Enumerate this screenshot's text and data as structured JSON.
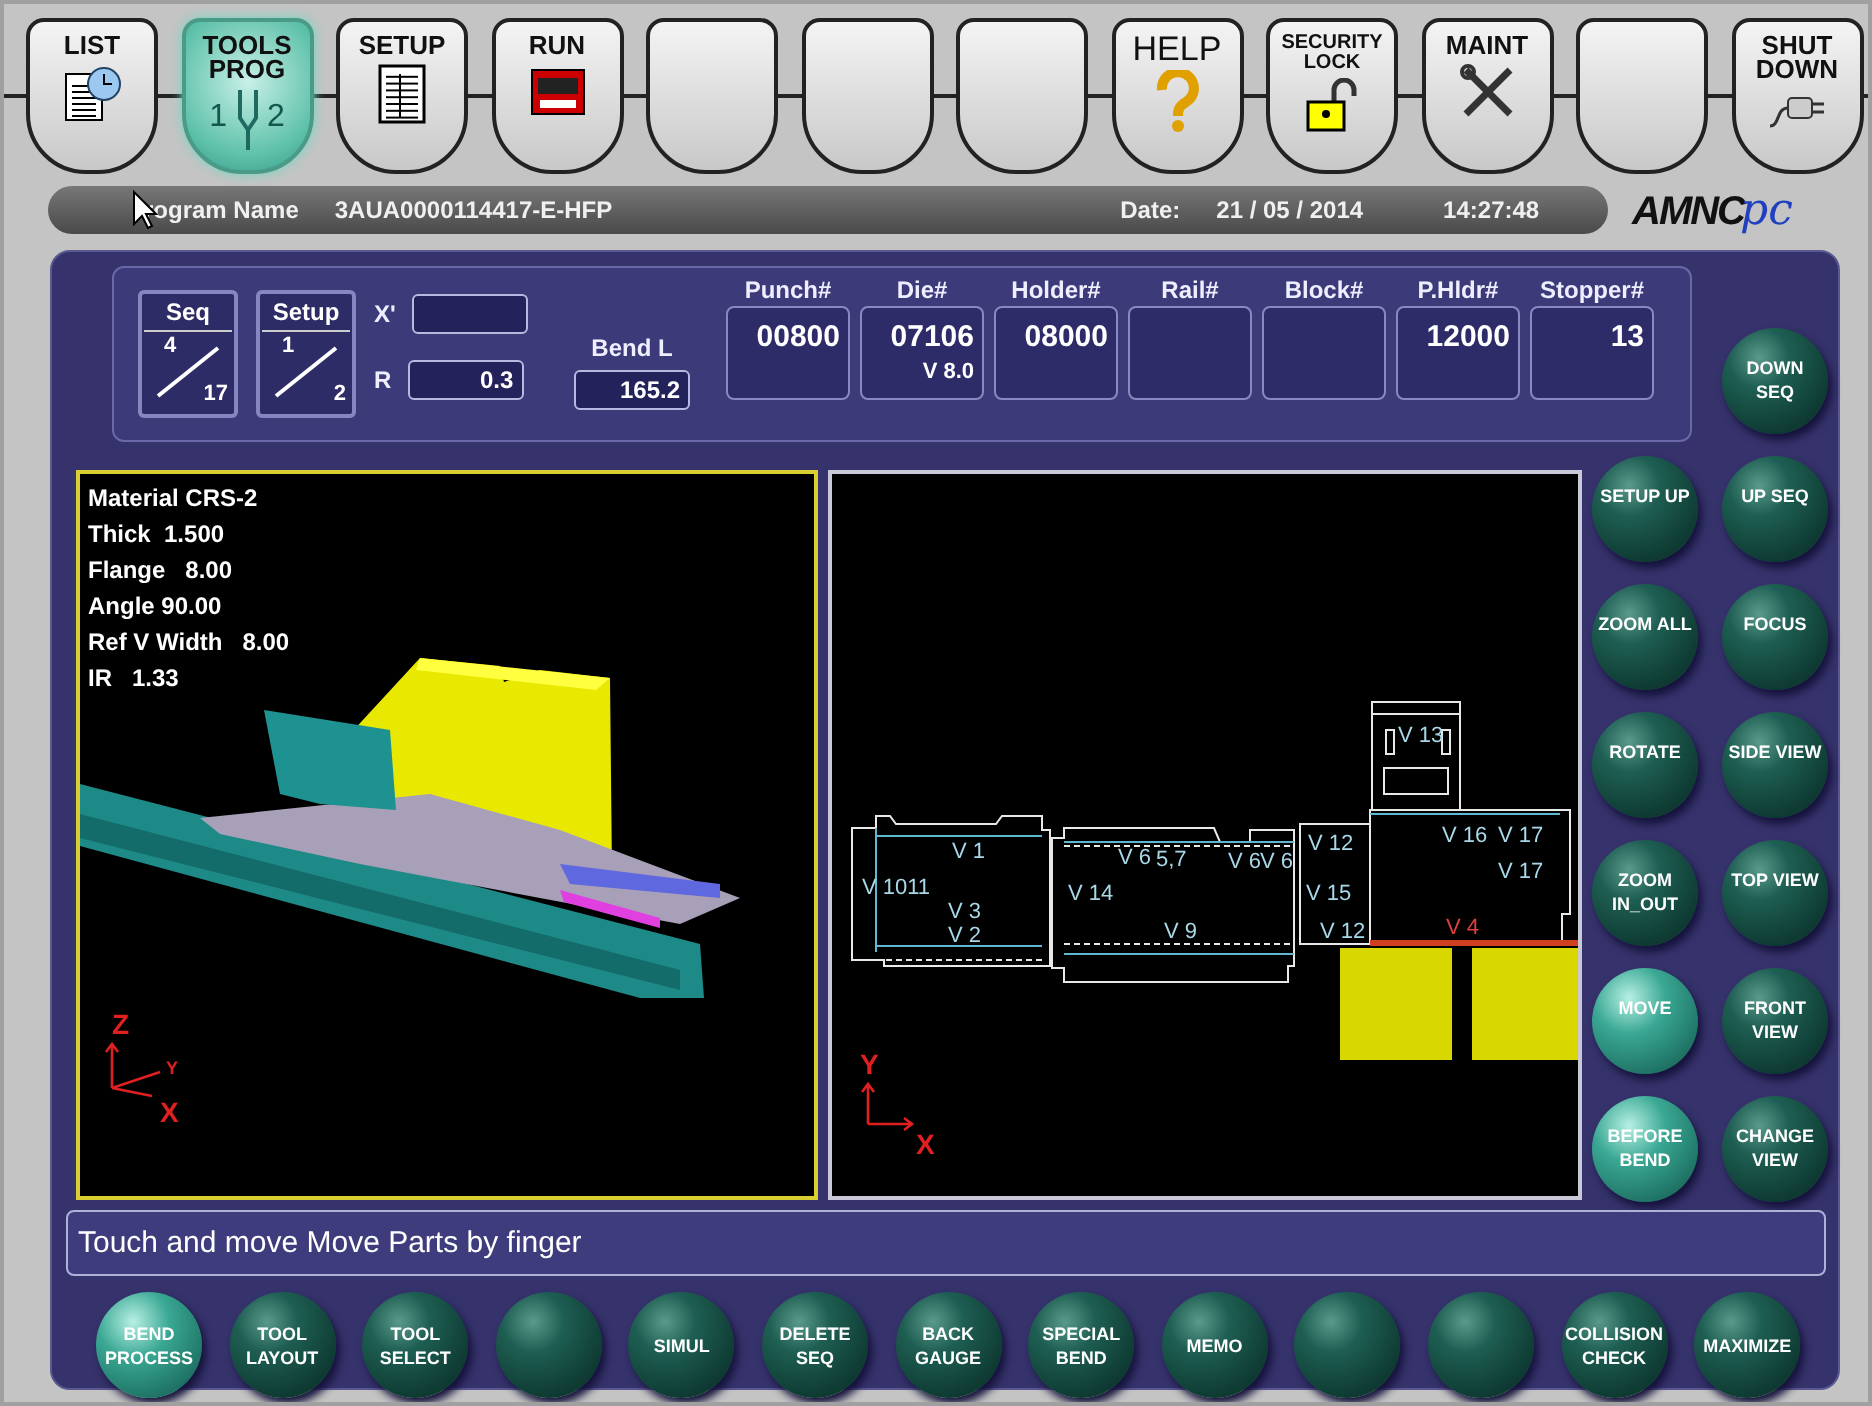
{
  "tabs": [
    {
      "label": "LIST",
      "selected": false
    },
    {
      "label": "TOOLS PROG",
      "selected": true,
      "step_labels": [
        "1",
        "2"
      ]
    },
    {
      "label": "SETUP",
      "selected": false
    },
    {
      "label": "RUN",
      "selected": false
    },
    {
      "selected": false
    },
    {
      "selected": false
    },
    {
      "selected": false
    },
    {
      "label": "HELP",
      "selected": false
    },
    {
      "label": "SECURITY LOCK",
      "selected": false
    },
    {
      "label": "MAINT",
      "selected": false
    },
    {
      "selected": false
    },
    {
      "label": "SHUT DOWN",
      "selected": false
    }
  ],
  "info_bar": {
    "program_label": "rogram Name",
    "program_name": "3AUA0000114417-E-HFP",
    "date_label": "Date:",
    "date": "21 / 05 / 2014",
    "time": "14:27:48",
    "logo": "AMNC",
    "logo_suffix": "pc"
  },
  "header": {
    "seq": {
      "label": "Seq",
      "current": "4",
      "total": "17"
    },
    "setup": {
      "label": "Setup",
      "current": "1",
      "total": "2"
    },
    "x_prime": {
      "label": "X'"
    },
    "r": {
      "label": "R",
      "value": "0.3"
    },
    "bend_l": {
      "label": "Bend L",
      "value": "165.2"
    },
    "tools": [
      {
        "label": "Punch#",
        "value": "00800"
      },
      {
        "label": "Die#",
        "value": "07106",
        "sub": "V 8.0"
      },
      {
        "label": "Holder#",
        "value": "08000"
      },
      {
        "label": "Rail#"
      },
      {
        "label": "Block#"
      },
      {
        "label": "P.Hldr#",
        "value": "12000"
      },
      {
        "label": "Stopper#",
        "value": "13"
      }
    ]
  },
  "view_3d": {
    "info": [
      "Material CRS-2",
      "Thick  1.500",
      "Flange   8.00",
      "Angle 90.00",
      "Ref V Width   8.00",
      "IR   1.33"
    ],
    "axes": [
      "Z",
      "Y",
      "X"
    ]
  },
  "view_2d": {
    "labels": [
      "V 1",
      "V 1011",
      "V 3",
      "V 2",
      "V 14",
      "V 6",
      "5,7",
      "V 9",
      "V 6",
      "V 6",
      "V 12",
      "V 15",
      "V 12",
      "V 13",
      "V 16",
      "V 17",
      "V 17",
      "V 4"
    ],
    "axes": [
      "Y",
      "X"
    ]
  },
  "side_buttons": [
    {
      "label": "DOWN SEQ",
      "active": false
    },
    {
      "label": "SETUP UP",
      "active": false
    },
    {
      "label": "UP SEQ",
      "active": false
    },
    {
      "label": "ZOOM ALL",
      "active": false
    },
    {
      "label": "FOCUS",
      "active": false
    },
    {
      "label": "ROTATE",
      "active": false
    },
    {
      "label": "SIDE VIEW",
      "active": false
    },
    {
      "label": "ZOOM IN_OUT",
      "active": false
    },
    {
      "label": "TOP VIEW",
      "active": false
    },
    {
      "label": "MOVE",
      "active": true
    },
    {
      "label": "FRONT VIEW",
      "active": false
    },
    {
      "label": "BEFORE BEND",
      "active": true
    },
    {
      "label": "CHANGE VIEW",
      "active": false
    }
  ],
  "message": "Touch and move Move Parts by finger",
  "bottom_buttons": [
    {
      "label": "BEND PROCESS",
      "active": true
    },
    {
      "label": "TOOL LAYOUT",
      "active": false
    },
    {
      "label": "TOOL SELECT",
      "active": false
    },
    {
      "active": false
    },
    {
      "label": "SIMUL",
      "active": false
    },
    {
      "label": "DELETE SEQ",
      "active": false
    },
    {
      "label": "BACK GAUGE",
      "active": false
    },
    {
      "label": "SPECIAL BEND",
      "active": false
    },
    {
      "label": "MEMO",
      "active": false
    },
    {
      "active": false
    },
    {
      "active": false
    },
    {
      "label": "COLLISION CHECK",
      "active": false
    },
    {
      "label": "MAXIMIZE",
      "active": false
    }
  ]
}
